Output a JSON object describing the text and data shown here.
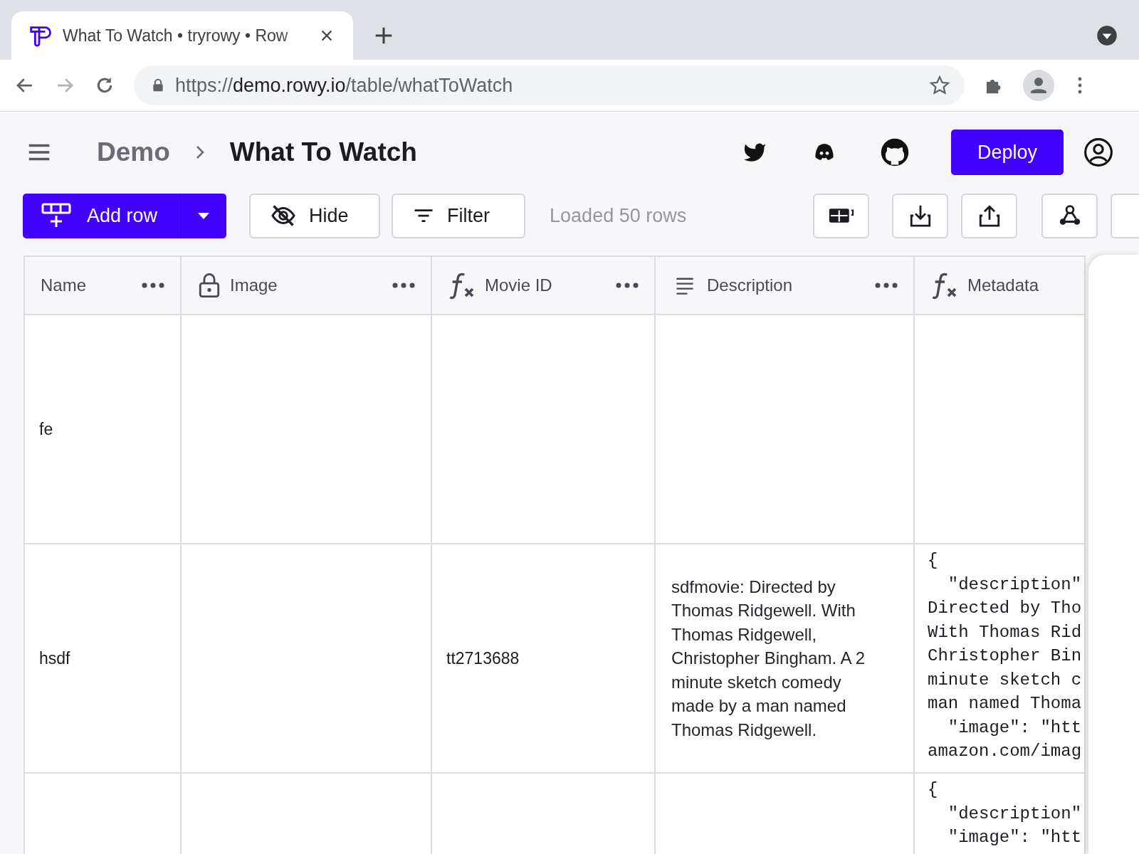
{
  "browser": {
    "tab": {
      "title": "What To Watch • tryrowy • Row",
      "selected": true
    },
    "url": {
      "scheme": "https://",
      "host": "demo.rowy.io",
      "path": "/table/whatToWatch"
    }
  },
  "header": {
    "breadcrumbs": [
      {
        "label": "Demo",
        "current": false
      },
      {
        "label": "What To Watch",
        "current": true
      }
    ],
    "deploy": "Deploy"
  },
  "toolbar": {
    "add_row": "Add row",
    "hide": "Hide",
    "filter": "Filter",
    "status": "Loaded 50 rows"
  },
  "table": {
    "columns": [
      {
        "label": "Name",
        "kind": "text",
        "menu": true
      },
      {
        "label": "Image",
        "kind": "locked",
        "menu": true
      },
      {
        "label": "Movie ID",
        "kind": "formula",
        "menu": true
      },
      {
        "label": "Description",
        "kind": "longtext",
        "menu": true
      },
      {
        "label": "Metadata",
        "kind": "formula",
        "menu": false
      }
    ],
    "rows": [
      {
        "name": "fe"
      },
      {
        "name": "hsdf",
        "movie_id": "tt2713688",
        "description": "sdfmovie: Directed by Thomas Ridgewell. With Thomas Ridgewell, Christopher Bingham. A 2 minute sketch comedy made by a man named Thomas Ridgewell.",
        "metadata": [
          "{",
          "  \"description\"",
          "Directed by Tho",
          "With Thomas Rid",
          "Christopher Bin",
          "minute sketch c",
          "man named Thoma",
          "  \"image\": \"htt",
          "amazon.com/imag"
        ]
      },
      {
        "metadata": [
          "{",
          "  \"description\"",
          "  \"image\": \"htt"
        ]
      }
    ]
  }
}
